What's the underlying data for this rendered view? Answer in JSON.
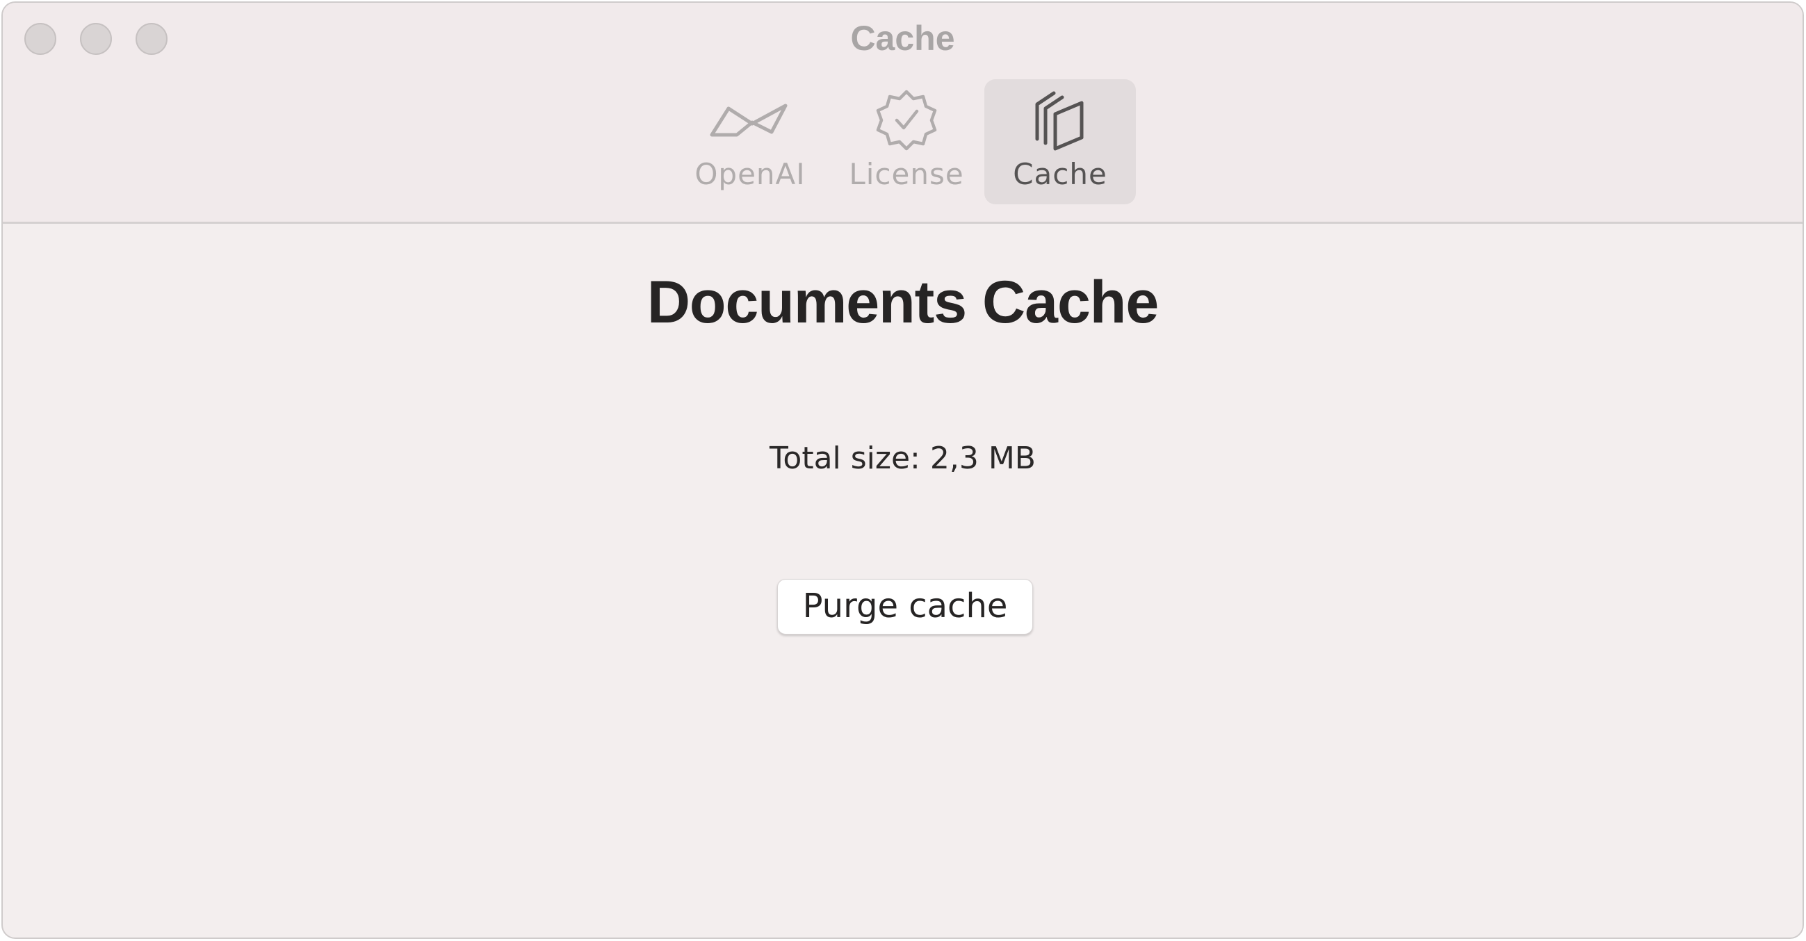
{
  "window": {
    "title": "Cache"
  },
  "traffic_lights": [
    "close",
    "minimize",
    "zoom"
  ],
  "toolbar": {
    "items": [
      {
        "label": "OpenAI",
        "icon": "openai-icon",
        "active": false
      },
      {
        "label": "License",
        "icon": "verified-badge-icon",
        "active": false
      },
      {
        "label": "Cache",
        "icon": "stacked-documents-icon",
        "active": true
      }
    ]
  },
  "main": {
    "heading": "Documents Cache",
    "total_size": "Total size: 2,3 MB",
    "purge_button_label": "Purge cache"
  },
  "colors": {
    "window_background": "#f3eeee",
    "titlebar_background": "#f1eaeb",
    "active_tab_background": "#e2dcdd",
    "inactive_label": "#b0acac",
    "active_label": "#555353",
    "heading_text": "#262424"
  }
}
